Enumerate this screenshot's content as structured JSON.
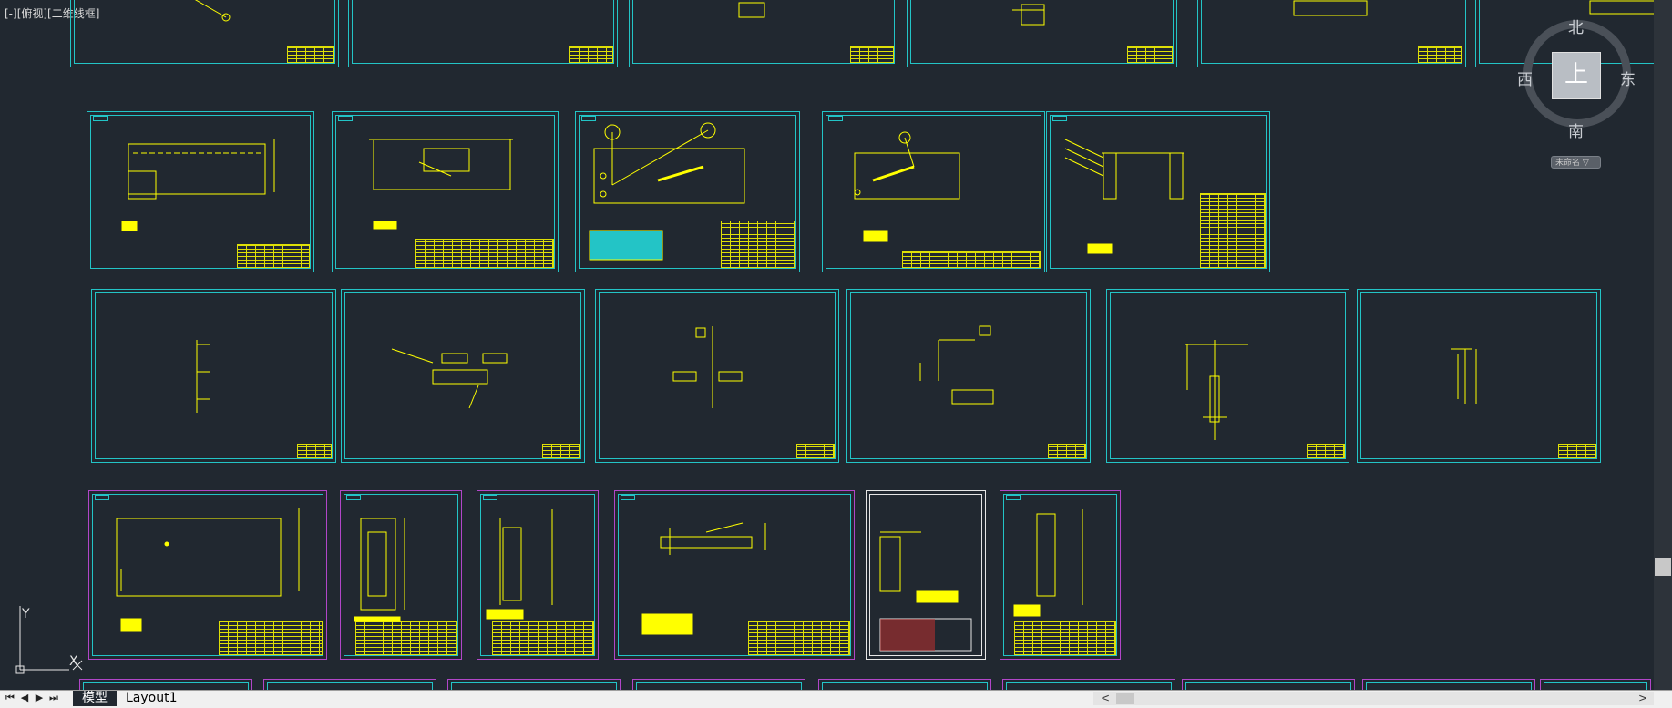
{
  "viewport": {
    "label": "[-][俯视][二维线框]"
  },
  "viewcube": {
    "top_face": "上",
    "north": "北",
    "south": "南",
    "east": "东",
    "west": "西",
    "ucs_menu": "未命名 ▽"
  },
  "ucs_icon": {
    "x_label": "X",
    "y_label": "Y"
  },
  "tabs": [
    {
      "label": "模型",
      "active": true
    },
    {
      "label": "Layout1",
      "active": false
    }
  ],
  "nav_buttons": [
    "first",
    "prev",
    "next",
    "last"
  ],
  "colors": {
    "background": "#212830",
    "frame_cyan": "#23c4c6",
    "frame_magenta": "#b146c8",
    "drawing_yellow": "#ffff00",
    "frame_white": "#e6e6e6"
  }
}
